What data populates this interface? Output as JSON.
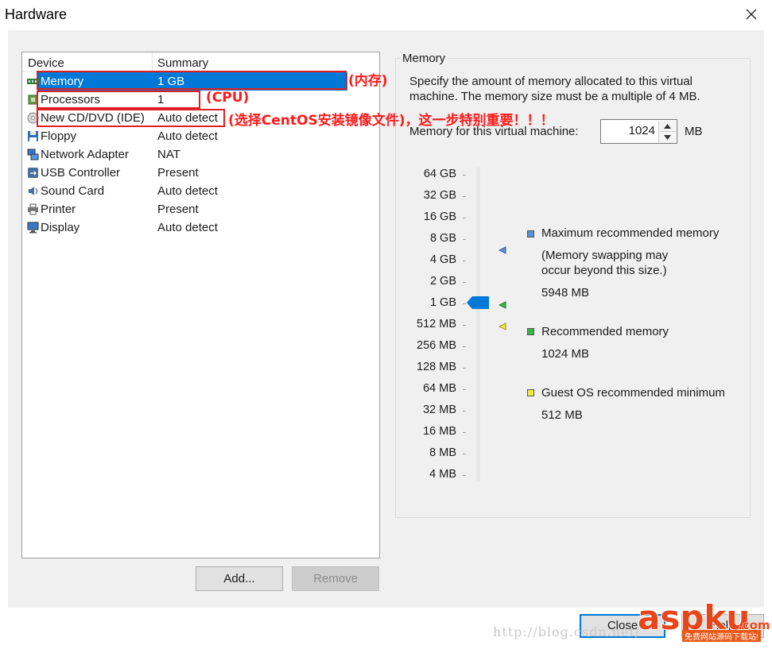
{
  "window": {
    "title": "Hardware"
  },
  "device_list": {
    "columns": [
      "Device",
      "Summary"
    ],
    "rows": [
      {
        "device": "Memory",
        "summary": "1 GB",
        "icon": "memory-icon",
        "selected": true
      },
      {
        "device": "Processors",
        "summary": "1",
        "icon": "processor-icon"
      },
      {
        "device": "New CD/DVD (IDE)",
        "summary": "Auto detect",
        "icon": "cd-dvd-icon"
      },
      {
        "device": "Floppy",
        "summary": "Auto detect",
        "icon": "floppy-icon"
      },
      {
        "device": "Network Adapter",
        "summary": "NAT",
        "icon": "network-adapter-icon"
      },
      {
        "device": "USB Controller",
        "summary": "Present",
        "icon": "usb-icon"
      },
      {
        "device": "Sound Card",
        "summary": "Auto detect",
        "icon": "sound-card-icon"
      },
      {
        "device": "Printer",
        "summary": "Present",
        "icon": "printer-icon"
      },
      {
        "device": "Display",
        "summary": "Auto detect",
        "icon": "display-icon"
      }
    ]
  },
  "annotations": {
    "memory": "(内存)",
    "cpu": "(CPU)",
    "cd": "(选择CentOS安装镜像文件)，这一步特别重要！！！"
  },
  "buttons": {
    "add": "Add...",
    "remove": "Remove",
    "close": "Close",
    "help": "Help"
  },
  "memory_panel": {
    "legend": "Memory",
    "description": "Specify the amount of memory allocated to this virtual machine. The memory size must be a multiple of 4 MB.",
    "for_vm_label": "Memory for this virtual machine:",
    "value": "1024",
    "unit": "MB",
    "scale": [
      "64 GB",
      "32 GB",
      "16 GB",
      "8 GB",
      "4 GB",
      "2 GB",
      "1 GB",
      "512 MB",
      "256 MB",
      "128 MB",
      "64 MB",
      "32 MB",
      "16 MB",
      "8 MB",
      "4 MB"
    ],
    "max_recommended": {
      "title": "Maximum recommended memory",
      "note_line1": "(Memory swapping may",
      "note_line2": "occur beyond this size.)",
      "value": "5948 MB",
      "color": "#5b8fd6"
    },
    "recommended": {
      "title": "Recommended memory",
      "value": "1024 MB",
      "color": "#39b54a"
    },
    "guest_min": {
      "title": "Guest OS recommended minimum",
      "value": "512 MB",
      "color": "#f5e642"
    }
  },
  "watermark": {
    "url": "http://blog.csdn.net/",
    "logo": "aspku",
    "logo_suffix": ".com",
    "sub": "免费网站源码下载站!"
  },
  "colors": {
    "selection": "#0078d7",
    "annotation": "#e02020"
  }
}
